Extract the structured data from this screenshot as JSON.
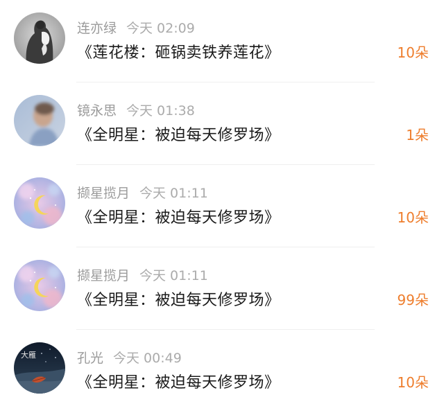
{
  "accent_color": "#ee7d2c",
  "rows": [
    {
      "name": "连亦绿",
      "time": "今天 02:09",
      "title": "《莲花楼：砸锅卖铁养莲花》",
      "count": "10朵",
      "avatar_icon": "back-silhouette-avatar"
    },
    {
      "name": "镜永思",
      "time": "今天 01:38",
      "title": "《全明星：被迫每天修罗场》",
      "count": "1朵",
      "avatar_icon": "blurred-person-avatar"
    },
    {
      "name": "撷星揽月",
      "time": "今天 01:11",
      "title": "《全明星：被迫每天修罗场》",
      "count": "10朵",
      "avatar_icon": "crescent-moon-avatar"
    },
    {
      "name": "撷星揽月",
      "time": "今天 01:11",
      "title": "《全明星：被迫每天修罗场》",
      "count": "99朵",
      "avatar_icon": "crescent-moon-avatar"
    },
    {
      "name": "孔光",
      "time": "今天 00:49",
      "title": "《全明星：被迫每天修罗场》",
      "count": "10朵",
      "avatar_icon": "dark-night-leaf-avatar",
      "avatar_text": "大雁"
    }
  ]
}
